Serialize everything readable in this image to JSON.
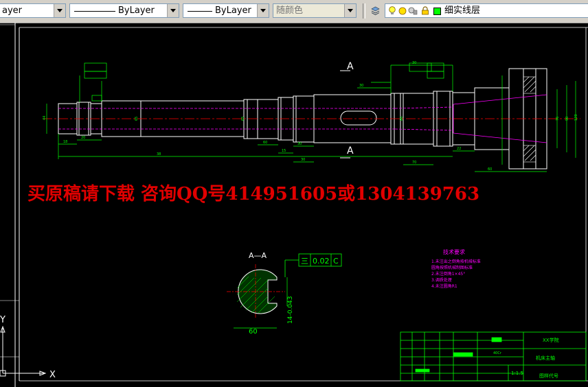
{
  "toolbar": {
    "layer_combo_text": "ayer",
    "linetype_combo_text": "ByLayer",
    "lineweight_combo_text": "ByLayer",
    "color_combo_text": "随颜色",
    "current_layer": "细实线层"
  },
  "drawing": {
    "watermark": "买原稿请下载  咨询QQ号414951605或1304139763",
    "section_label": "A—A",
    "section_marker_top": "A",
    "section_marker_bottom": "A",
    "tolerance_symbol": "三",
    "tolerance_value": "0.02",
    "tolerance_datum": "C",
    "keyway_dim_width": "60",
    "keyway_dim_depth": "14-0.043",
    "tech_title": "技术要求",
    "tech_items": [
      "1.未注出之倒角按机械标准",
      "  圆角按照机械制图标准",
      "2.未注倒角1×45°",
      "3.调质处理",
      "4.未注圆角R1"
    ],
    "title_block": {
      "school": "XX学院",
      "material": "40Cr",
      "part_name": "机床主轴",
      "scale": "1:1.5",
      "drawing_no": "图样代号"
    },
    "ucs_x": "X",
    "ucs_y": "Y"
  },
  "colors": {
    "background": "#000000",
    "geometry": "#ffffff",
    "dimension": "#00ff00",
    "center_line": "#ff0000",
    "hidden_line": "#ff00ff",
    "watermark": "#e00000"
  }
}
